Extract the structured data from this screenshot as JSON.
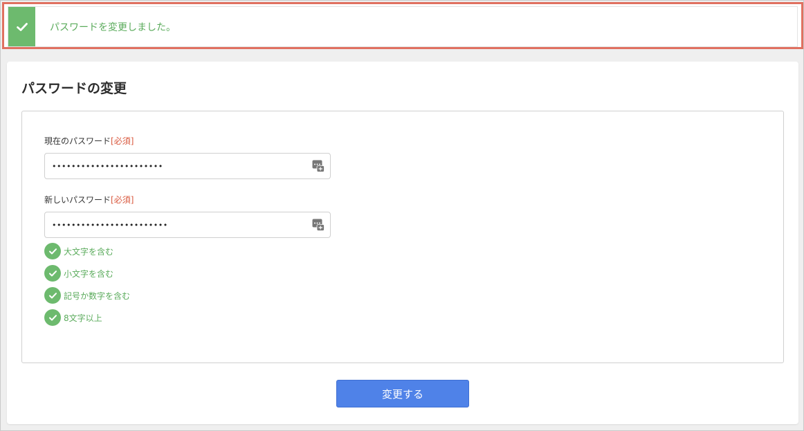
{
  "alert": {
    "message": "パスワードを変更しました。",
    "icon": "check-icon",
    "color": "#6dba6e"
  },
  "card": {
    "title": "パスワードの変更"
  },
  "form": {
    "current_password": {
      "label": "現在のパスワード",
      "required": "[必須]",
      "value_masked": "•••••••••••••••••••••••",
      "icon": "password-key-icon"
    },
    "new_password": {
      "label": "新しいパスワード",
      "required": "[必須]",
      "value_masked": "••••••••••••••••••••••••",
      "icon": "password-key-icon"
    },
    "rules": [
      {
        "label": "大文字を含む",
        "satisfied": true
      },
      {
        "label": "小文字を含む",
        "satisfied": true
      },
      {
        "label": "記号か数字を含む",
        "satisfied": true
      },
      {
        "label": "8文字以上",
        "satisfied": true
      }
    ],
    "submit_label": "変更する"
  },
  "colors": {
    "success": "#6dba6e",
    "required": "#d9583e",
    "primary_button": "#4f82e8",
    "highlight_border": "#e07060"
  }
}
